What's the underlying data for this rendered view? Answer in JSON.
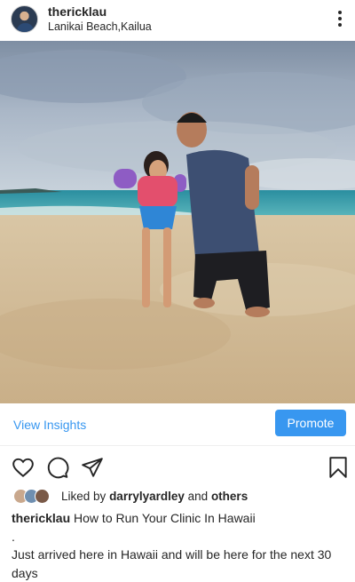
{
  "post": {
    "username": "thericklau",
    "location": "Lanikai Beach,Kailua"
  },
  "insights": {
    "view_label": "View Insights",
    "promote_label": "Promote"
  },
  "likes": {
    "prefix": "Liked by",
    "user": "darrylyardley",
    "conjunction": "and",
    "others": "others"
  },
  "caption": {
    "username": "thericklau",
    "title": "How to Run Your Clinic In Hawaii",
    "dot": ".",
    "body": "Just arrived here in Hawaii and will be here for the next 30 days"
  },
  "icons": {
    "more": "more-vertical-icon",
    "like": "heart-icon",
    "comment": "comment-icon",
    "share": "paper-plane-icon",
    "save": "bookmark-icon"
  },
  "colors": {
    "accent": "#3897f0",
    "text": "#262626"
  }
}
